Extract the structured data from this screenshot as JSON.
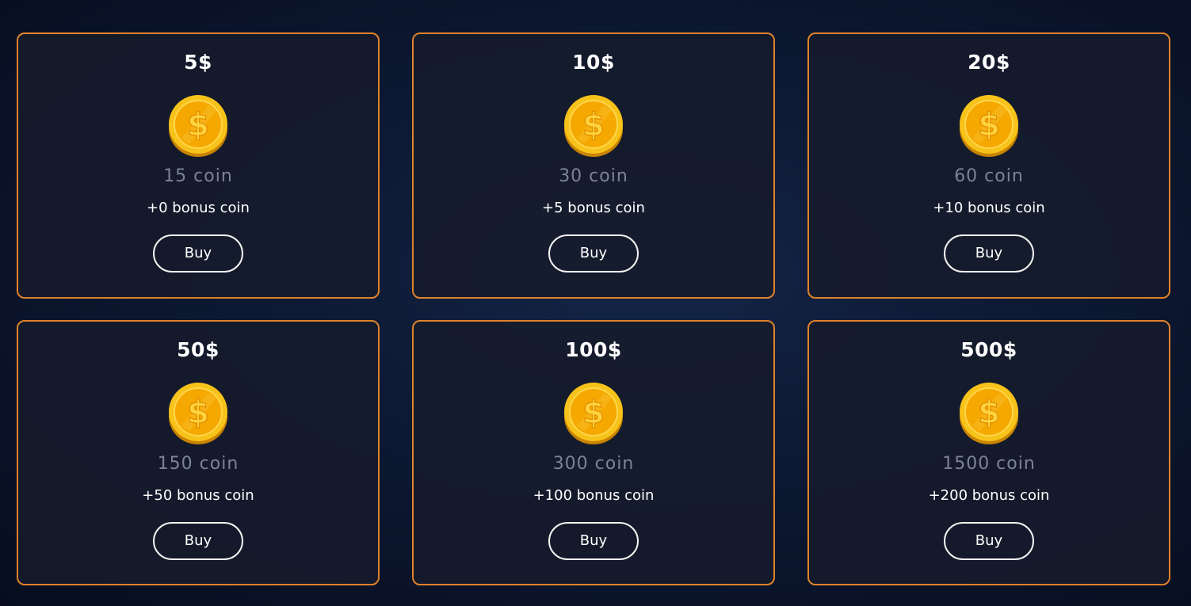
{
  "packages": [
    {
      "price": "5$",
      "coins": "15 coin",
      "bonus": "+0 bonus coin",
      "button": "Buy"
    },
    {
      "price": "10$",
      "coins": "30 coin",
      "bonus": "+5 bonus coin",
      "button": "Buy"
    },
    {
      "price": "20$",
      "coins": "60 coin",
      "bonus": "+10 bonus coin",
      "button": "Buy"
    },
    {
      "price": "50$",
      "coins": "150 coin",
      "bonus": "+50 bonus coin",
      "button": "Buy"
    },
    {
      "price": "100$",
      "coins": "300 coin",
      "bonus": "+100 bonus coin",
      "button": "Buy"
    },
    {
      "price": "500$",
      "coins": "1500 coin",
      "bonus": "+200 bonus coin",
      "button": "Buy"
    }
  ],
  "icons": {
    "coin": "gold-dollar-coin-icon"
  },
  "colors": {
    "card_border": "#e0822a",
    "card_background": "#161b2b",
    "page_background": "#0a1329",
    "coin_gold": "#f5b400",
    "coin_amount_text": "#7c8494",
    "text": "#ffffff"
  }
}
